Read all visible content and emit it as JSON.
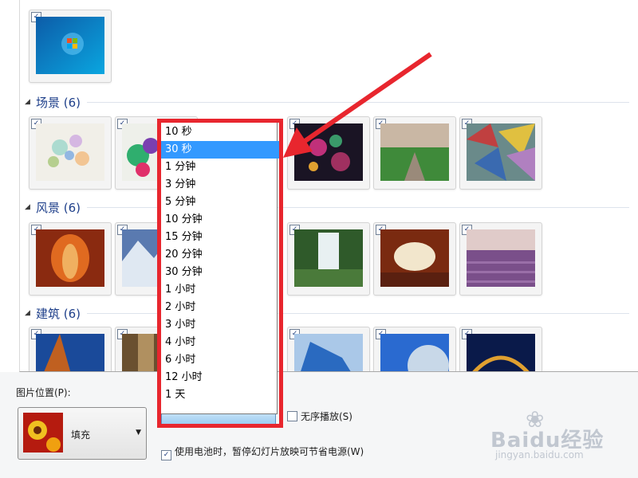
{
  "groups": {
    "first_title": "",
    "scenes_title": "场景 (6)",
    "landscape_title": "风景 (6)",
    "architecture_title": "建筑 (6)"
  },
  "interval_dropdown": {
    "options": [
      "10 秒",
      "30 秒",
      "1 分钟",
      "3 分钟",
      "5 分钟",
      "10 分钟",
      "15 分钟",
      "20 分钟",
      "30 分钟",
      "1 小时",
      "2 小时",
      "3 小时",
      "4 小时",
      "6 小时",
      "12 小时",
      "1 天"
    ],
    "selected": "30 秒"
  },
  "picture_position": {
    "label": "图片位置(P):",
    "value": "填充"
  },
  "shuffle": {
    "label": "无序播放(S)",
    "checked": false
  },
  "battery": {
    "label": "使用电池时，暂停幻灯片放映可节省电源(W)",
    "checked": true
  },
  "checkmark": "✓",
  "watermark": {
    "brand": "Baidu经验",
    "site": "jingyan.baidu.com"
  },
  "colors": {
    "highlight": "#3399ff",
    "annotation": "#e8262e",
    "group_title": "#1e3f8a"
  }
}
